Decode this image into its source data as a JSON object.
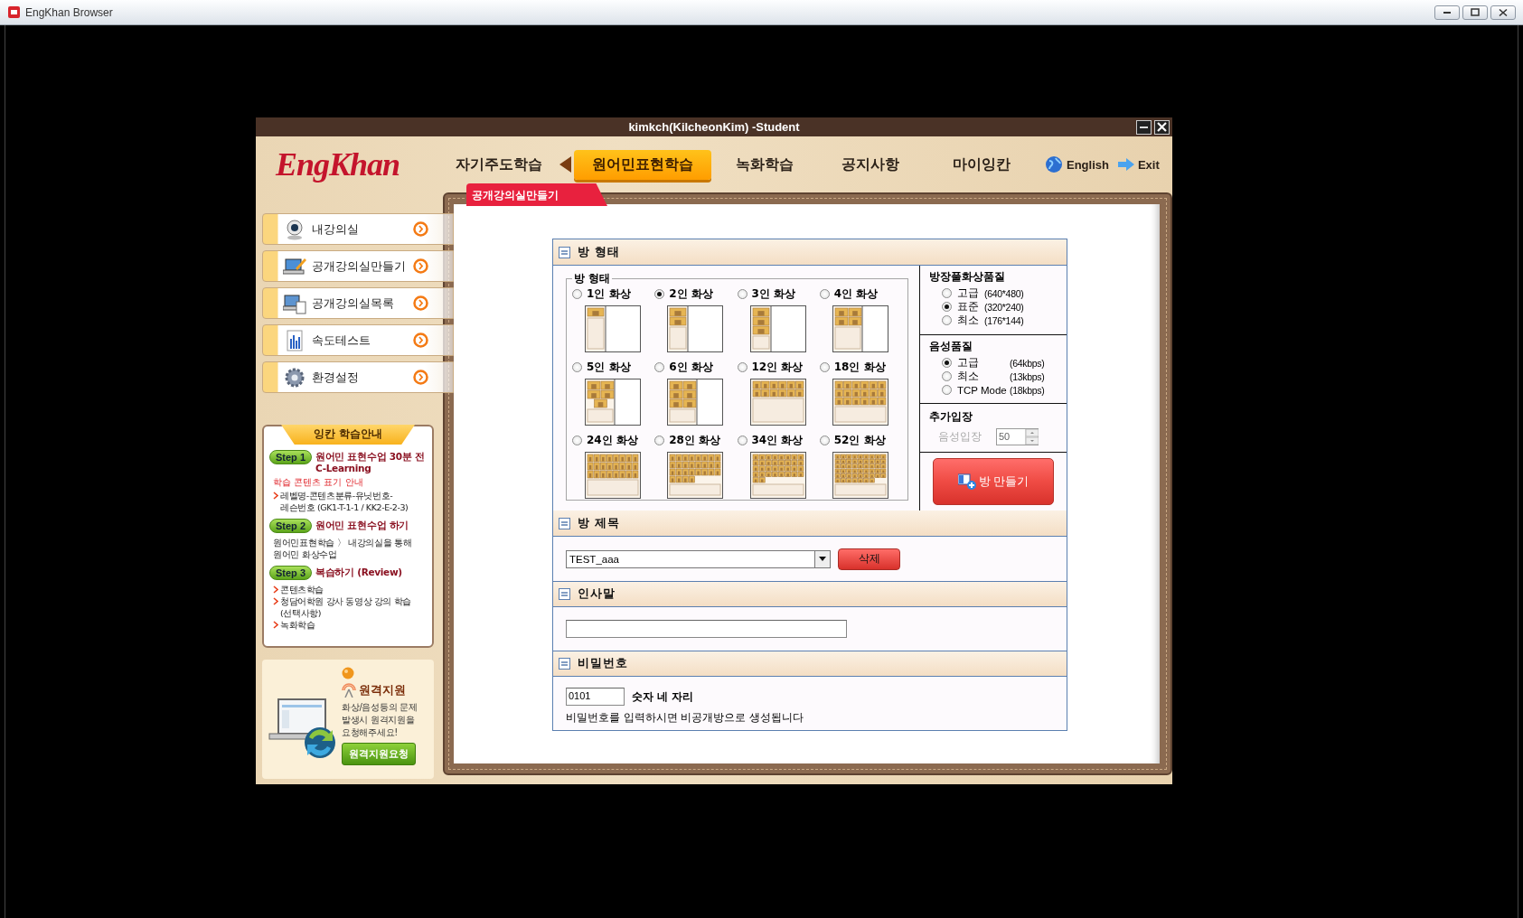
{
  "window": {
    "title": "EngKhan Browser"
  },
  "app": {
    "title": "kimkch(KilcheonKim) -Student",
    "logo": "EngKhan"
  },
  "nav": {
    "items": [
      {
        "label": "자기주도학습",
        "selected": false
      },
      {
        "label": "원어민표현학습",
        "selected": true
      },
      {
        "label": "녹화학습",
        "selected": false
      },
      {
        "label": "공지사항",
        "selected": false
      },
      {
        "label": "마이잉칸",
        "selected": false
      }
    ],
    "language": "English",
    "exit": "Exit"
  },
  "page_tab": "공개강의실만들기",
  "sidebar": {
    "items": [
      {
        "label": "내강의실"
      },
      {
        "label": "공개강의실만들기"
      },
      {
        "label": "공개강의실목록"
      },
      {
        "label": "속도테스트"
      },
      {
        "label": "환경설정"
      }
    ]
  },
  "guide": {
    "title": "잉칸 학습안내",
    "steps": [
      {
        "badge": "Step 1",
        "title": "원어민 표현수업 30분 전 C-Learning",
        "note": "학습 콘텐츠 표기 안내",
        "bullets": [
          "레벨명-콘텐츠분류-유닛번호-레슨번호 (GK1-T-1-1 / KK2-E-2-3)"
        ]
      },
      {
        "badge": "Step 2",
        "title": "원어민 표현수업 하기",
        "text": "원어민표현학습 〉 내강의실을 통해 원어민 화상수업"
      },
      {
        "badge": "Step 3",
        "title": "복습하기 (Review)",
        "bullets": [
          "콘텐츠학습",
          "청담어학원 강사 동영상 강의 학습(선택사항)",
          "녹화학습"
        ]
      }
    ]
  },
  "remote": {
    "title": "원격지원",
    "text": "화상/음성등의 문제 발생시 원격지원을 요청해주세요!",
    "button": "원격지원요청"
  },
  "form": {
    "room_type": {
      "header": "방 형태",
      "legend": "방 형태",
      "options": [
        {
          "label": "1인 화상",
          "selected": false,
          "kind": "side"
        },
        {
          "label": "2인 화상",
          "selected": true,
          "kind": "side"
        },
        {
          "label": "3인 화상",
          "selected": false,
          "kind": "side"
        },
        {
          "label": "4인 화상",
          "selected": false,
          "kind": "side"
        },
        {
          "label": "5인 화상",
          "selected": false,
          "kind": "side"
        },
        {
          "label": "6인 화상",
          "selected": false,
          "kind": "side"
        },
        {
          "label": "12인 화상",
          "selected": false,
          "kind": "grid"
        },
        {
          "label": "18인 화상",
          "selected": false,
          "kind": "grid"
        },
        {
          "label": "24인 화상",
          "selected": false,
          "kind": "grid"
        },
        {
          "label": "28인 화상",
          "selected": false,
          "kind": "grid"
        },
        {
          "label": "34인 화상",
          "selected": false,
          "kind": "grid"
        },
        {
          "label": "52인 화상",
          "selected": false,
          "kind": "grid"
        }
      ]
    },
    "video_quality": {
      "title": "방장풀화상품질",
      "options": [
        {
          "label": "고급",
          "detail": "(640*480)",
          "selected": false
        },
        {
          "label": "표준",
          "detail": "(320*240)",
          "selected": true
        },
        {
          "label": "최소",
          "detail": "(176*144)",
          "selected": false
        }
      ]
    },
    "audio_quality": {
      "title": "음성품질",
      "options": [
        {
          "label": "고급",
          "detail": "(64kbps)",
          "selected": true
        },
        {
          "label": "최소",
          "detail": "(13kbps)",
          "selected": false
        },
        {
          "label": "TCP Mode",
          "detail": "(18kbps)",
          "selected": false
        }
      ]
    },
    "extra": {
      "title": "추가입장",
      "label": "음성입장",
      "value": "50",
      "disabled": true
    },
    "create_button": "방 만들기",
    "room_title": {
      "header": "방 제목",
      "value": "TEST_aaa",
      "delete_button": "삭제"
    },
    "greeting": {
      "header": "인사말"
    },
    "password": {
      "header": "비밀번호",
      "value": "0101",
      "hint": "숫자 네 자리",
      "note": "비밀번호를 입력하시면 비공개방으로 생성됩니다"
    }
  }
}
